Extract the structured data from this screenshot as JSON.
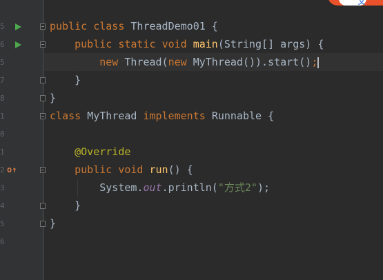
{
  "editor": {
    "lines": [
      {
        "tokens": [
          {
            "t": "public ",
            "c": "kw"
          },
          {
            "t": "class ",
            "c": "kw"
          },
          {
            "t": "ThreadDemo01 {",
            "c": ""
          }
        ]
      },
      {
        "tokens": [
          {
            "t": "    public ",
            "c": "kw"
          },
          {
            "t": "static ",
            "c": "kw"
          },
          {
            "t": "void ",
            "c": "kw"
          },
          {
            "t": "main",
            "c": "fn"
          },
          {
            "t": "(String[] args) {",
            "c": ""
          }
        ]
      },
      {
        "tokens": [
          {
            "t": "        new ",
            "c": "kw"
          },
          {
            "t": "Thread(",
            "c": ""
          },
          {
            "t": "new ",
            "c": "kw"
          },
          {
            "t": "MyThread()).start()",
            "c": ""
          },
          {
            "t": ";",
            "c": "kw"
          }
        ]
      },
      {
        "tokens": [
          {
            "t": "    }",
            "c": ""
          }
        ]
      },
      {
        "tokens": [
          {
            "t": "}",
            "c": ""
          }
        ]
      },
      {
        "tokens": [
          {
            "t": "class ",
            "c": "kw"
          },
          {
            "t": "MyThread ",
            "c": ""
          },
          {
            "t": "implements ",
            "c": "kw"
          },
          {
            "t": "Runnable {",
            "c": ""
          }
        ]
      },
      {
        "tokens": [
          {
            "t": "",
            "c": ""
          }
        ]
      },
      {
        "tokens": [
          {
            "t": "    ",
            "c": ""
          },
          {
            "t": "@Override",
            "c": "ann"
          }
        ]
      },
      {
        "tokens": [
          {
            "t": "    public ",
            "c": "kw"
          },
          {
            "t": "void ",
            "c": "kw"
          },
          {
            "t": "run",
            "c": "fn"
          },
          {
            "t": "() {",
            "c": ""
          }
        ]
      },
      {
        "tokens": [
          {
            "t": "        System.",
            "c": ""
          },
          {
            "t": "out",
            "c": "st"
          },
          {
            "t": ".println(",
            "c": ""
          },
          {
            "t": "\"方式2\"",
            "c": "str"
          },
          {
            "t": ");",
            "c": ""
          }
        ]
      },
      {
        "tokens": [
          {
            "t": "    }",
            "c": ""
          }
        ]
      },
      {
        "tokens": [
          {
            "t": "}",
            "c": ""
          }
        ]
      }
    ]
  },
  "gutter": {
    "line_numbers": [
      "",
      "5",
      "6",
      "5",
      "7",
      "8",
      "1",
      "0",
      "1",
      "2",
      "3",
      "4",
      "5",
      "6",
      "7"
    ],
    "impl_marker": "o↑"
  },
  "badge": {
    "text": "文"
  },
  "colors": {
    "background": "#2b2b2b",
    "keyword": "#cc7832",
    "method": "#ffc66d",
    "annotation": "#bbb529",
    "string": "#6a8759",
    "static_field": "#9876aa",
    "text": "#a9b7c6"
  }
}
